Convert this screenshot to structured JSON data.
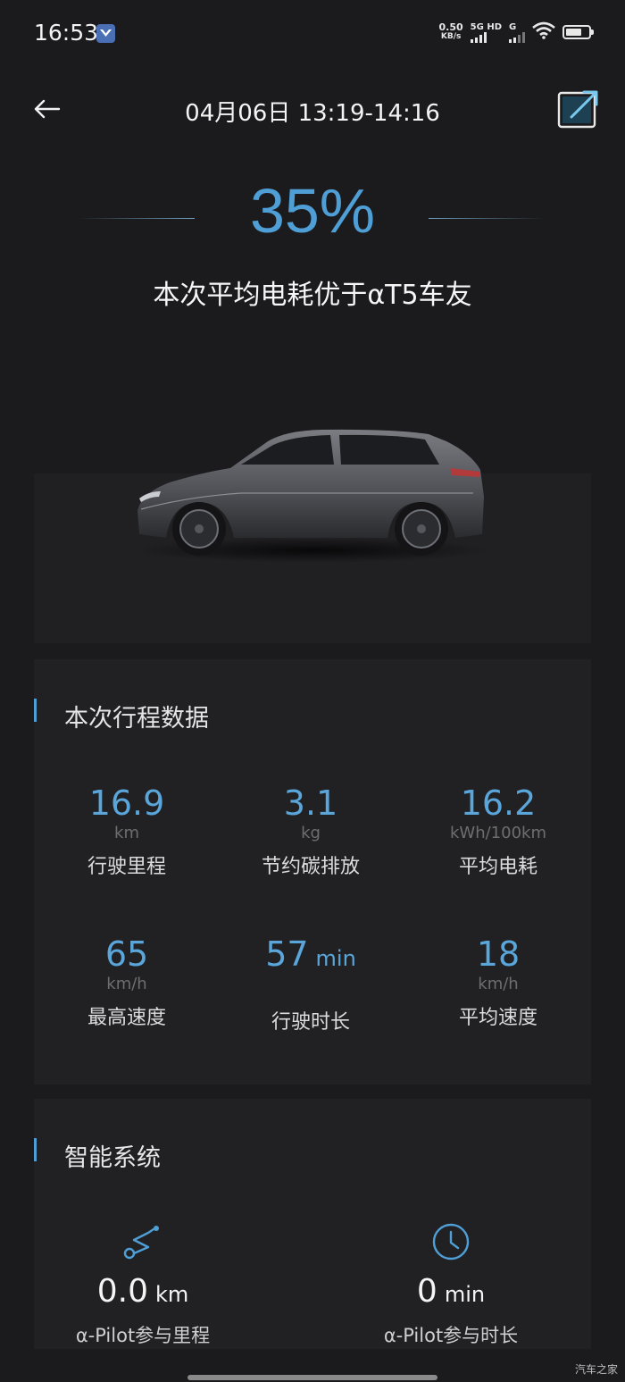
{
  "status_bar": {
    "time": "16:53",
    "net_speed_value": "0.50",
    "net_speed_unit": "KB/s",
    "network_label": "5G HD",
    "network2_label": "G",
    "icons": [
      "app-notification-icon",
      "signal-icon",
      "wifi-icon",
      "battery-icon"
    ]
  },
  "header": {
    "title": "04月06日 13:19-14:16",
    "back_icon": "arrow-left-icon",
    "share_icon": "share-export-icon"
  },
  "hero": {
    "percent": "35%",
    "subtitle": "本次平均电耗优于αT5车友"
  },
  "trip_section": {
    "title": "本次行程数据",
    "stats": [
      {
        "value": "16.9",
        "unit": "km",
        "label": "行驶里程"
      },
      {
        "value": "3.1",
        "unit": "kg",
        "label": "节约碳排放"
      },
      {
        "value": "16.2",
        "unit": "kWh/100km",
        "label": "平均电耗"
      },
      {
        "value": "65",
        "unit": "km/h",
        "label": "最高速度"
      },
      {
        "value": "57",
        "inline_unit": "min",
        "unit": "",
        "label": "行驶时长"
      },
      {
        "value": "18",
        "unit": "km/h",
        "label": "平均速度"
      }
    ]
  },
  "smart_section": {
    "title": "智能系统",
    "items": [
      {
        "icon": "route-icon",
        "value": "0.0",
        "unit": "km",
        "label": "α-Pilot参与里程"
      },
      {
        "icon": "clock-icon",
        "value": "0",
        "unit": "min",
        "label": "α-Pilot参与时长"
      }
    ]
  },
  "watermark": "汽车之家",
  "colors": {
    "background": "#1b1b1d",
    "card": "#212124",
    "accent": "#4f9fd6",
    "text": "#ececec"
  }
}
